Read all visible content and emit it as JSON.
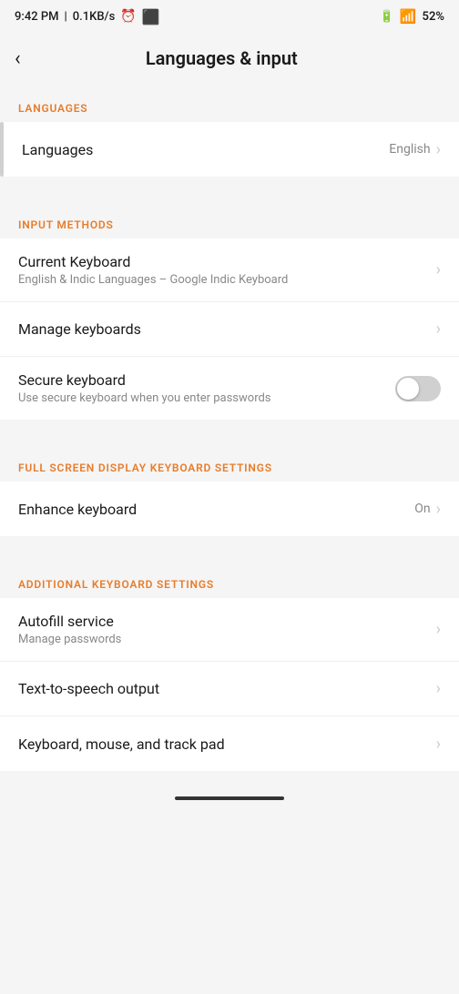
{
  "statusBar": {
    "time": "9:42 PM",
    "network": "0.1KB/s",
    "battery": "52"
  },
  "header": {
    "backLabel": "‹",
    "title": "Languages & input"
  },
  "sections": {
    "languages": {
      "label": "LANGUAGES",
      "items": [
        {
          "title": "Languages",
          "subtitle": "",
          "rightText": "English",
          "hasChevron": true,
          "hasToggle": false
        }
      ]
    },
    "inputMethods": {
      "label": "INPUT METHODS",
      "items": [
        {
          "title": "Current Keyboard",
          "subtitle": "English & Indic Languages – Google Indic Keyboard",
          "rightText": "",
          "hasChevron": true,
          "hasToggle": false
        },
        {
          "title": "Manage keyboards",
          "subtitle": "",
          "rightText": "",
          "hasChevron": true,
          "hasToggle": false
        },
        {
          "title": "Secure keyboard",
          "subtitle": "Use secure keyboard when you enter passwords",
          "rightText": "",
          "hasChevron": false,
          "hasToggle": true
        }
      ]
    },
    "fullScreen": {
      "label": "FULL SCREEN DISPLAY KEYBOARD SETTINGS",
      "items": [
        {
          "title": "Enhance keyboard",
          "subtitle": "",
          "rightText": "On",
          "hasChevron": true,
          "hasToggle": false
        }
      ]
    },
    "additional": {
      "label": "ADDITIONAL KEYBOARD SETTINGS",
      "items": [
        {
          "title": "Autofill service",
          "subtitle": "Manage passwords",
          "rightText": "",
          "hasChevron": true,
          "hasToggle": false
        },
        {
          "title": "Text-to-speech output",
          "subtitle": "",
          "rightText": "",
          "hasChevron": true,
          "hasToggle": false
        },
        {
          "title": "Keyboard, mouse, and track pad",
          "subtitle": "",
          "rightText": "",
          "hasChevron": true,
          "hasToggle": false
        }
      ]
    }
  }
}
